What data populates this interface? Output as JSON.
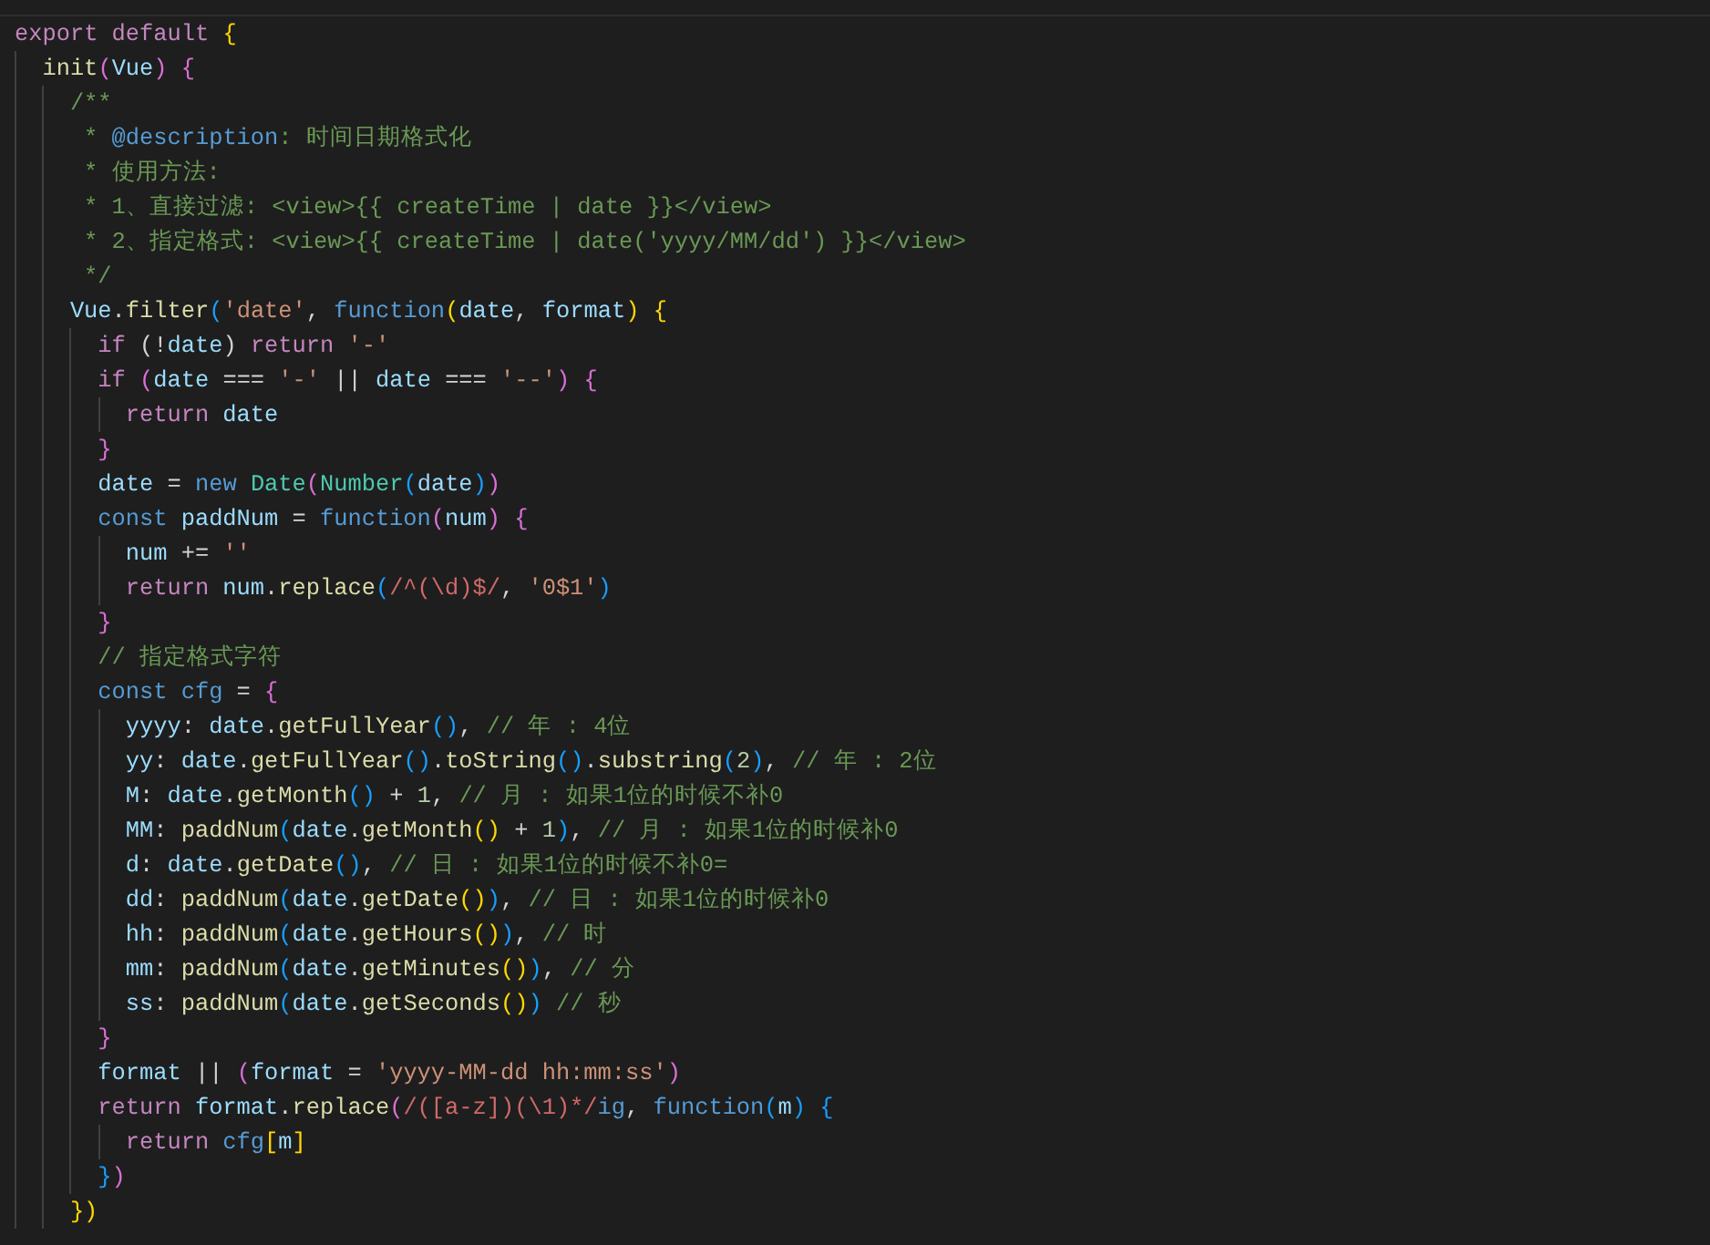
{
  "editor": {
    "lines": [
      {
        "tokens": [
          {
            "kind": "kw",
            "text": "export "
          },
          {
            "kind": "kw",
            "text": "default "
          },
          {
            "kind": "br1",
            "text": "{"
          }
        ],
        "children": [
          {
            "tokens": [
              {
                "kind": "fn",
                "text": "init"
              },
              {
                "kind": "br2",
                "text": "("
              },
              {
                "kind": "var",
                "text": "Vue"
              },
              {
                "kind": "br2",
                "text": ")"
              },
              {
                "kind": "br2",
                "text": " {"
              }
            ],
            "children": [
              {
                "tokens": [
                  {
                    "kind": "com",
                    "text": "/**"
                  }
                ]
              },
              {
                "tokens": [
                  {
                    "kind": "com",
                    "text": " * "
                  },
                  {
                    "kind": "doc",
                    "text": "@description"
                  },
                  {
                    "kind": "com",
                    "text": ": 时间日期格式化"
                  }
                ]
              },
              {
                "tokens": [
                  {
                    "kind": "com",
                    "text": " * 使用方法:"
                  }
                ]
              },
              {
                "tokens": [
                  {
                    "kind": "com",
                    "text": " * 1、直接过滤: <view>{{ createTime | date }}</view>"
                  }
                ]
              },
              {
                "tokens": [
                  {
                    "kind": "com",
                    "text": " * 2、指定格式: <view>{{ createTime | date('yyyy/MM/dd') }}</view>"
                  }
                ]
              },
              {
                "tokens": [
                  {
                    "kind": "com",
                    "text": " */"
                  }
                ]
              },
              {
                "tokens": [
                  {
                    "kind": "var",
                    "text": "Vue"
                  },
                  {
                    "kind": "pun",
                    "text": "."
                  },
                  {
                    "kind": "fn",
                    "text": "filter"
                  },
                  {
                    "kind": "br3",
                    "text": "("
                  },
                  {
                    "kind": "str",
                    "text": "'date'"
                  },
                  {
                    "kind": "pun",
                    "text": ", "
                  },
                  {
                    "kind": "st",
                    "text": "function"
                  },
                  {
                    "kind": "br1",
                    "text": "("
                  },
                  {
                    "kind": "var",
                    "text": "date"
                  },
                  {
                    "kind": "pun",
                    "text": ", "
                  },
                  {
                    "kind": "var",
                    "text": "format"
                  },
                  {
                    "kind": "br1",
                    "text": ")"
                  },
                  {
                    "kind": "br1",
                    "text": " {"
                  }
                ],
                "children": [
                  {
                    "tokens": [
                      {
                        "kind": "kw",
                        "text": "if "
                      },
                      {
                        "kind": "pun",
                        "text": "(!"
                      },
                      {
                        "kind": "var",
                        "text": "date"
                      },
                      {
                        "kind": "pun",
                        "text": ") "
                      },
                      {
                        "kind": "kw",
                        "text": "return "
                      },
                      {
                        "kind": "str",
                        "text": "'-'"
                      }
                    ]
                  },
                  {
                    "tokens": [
                      {
                        "kind": "kw",
                        "text": "if "
                      },
                      {
                        "kind": "br2",
                        "text": "("
                      },
                      {
                        "kind": "var",
                        "text": "date"
                      },
                      {
                        "kind": "pun",
                        "text": " === "
                      },
                      {
                        "kind": "str",
                        "text": "'-'"
                      },
                      {
                        "kind": "pun",
                        "text": " || "
                      },
                      {
                        "kind": "var",
                        "text": "date"
                      },
                      {
                        "kind": "pun",
                        "text": " === "
                      },
                      {
                        "kind": "str",
                        "text": "'--'"
                      },
                      {
                        "kind": "br2",
                        "text": ")"
                      },
                      {
                        "kind": "br2",
                        "text": " {"
                      }
                    ],
                    "children": [
                      {
                        "tokens": [
                          {
                            "kind": "kw",
                            "text": "return "
                          },
                          {
                            "kind": "var",
                            "text": "date"
                          }
                        ]
                      }
                    ]
                  },
                  {
                    "tokens": [
                      {
                        "kind": "br2",
                        "text": "}"
                      }
                    ]
                  },
                  {
                    "tokens": [
                      {
                        "kind": "var",
                        "text": "date"
                      },
                      {
                        "kind": "pun",
                        "text": " = "
                      },
                      {
                        "kind": "st",
                        "text": "new "
                      },
                      {
                        "kind": "cls",
                        "text": "Date"
                      },
                      {
                        "kind": "br2",
                        "text": "("
                      },
                      {
                        "kind": "cls",
                        "text": "Number"
                      },
                      {
                        "kind": "br3",
                        "text": "("
                      },
                      {
                        "kind": "var",
                        "text": "date"
                      },
                      {
                        "kind": "br3",
                        "text": ")"
                      },
                      {
                        "kind": "br2",
                        "text": ")"
                      }
                    ]
                  },
                  {
                    "tokens": [
                      {
                        "kind": "st",
                        "text": "const "
                      },
                      {
                        "kind": "var",
                        "text": "paddNum"
                      },
                      {
                        "kind": "pun",
                        "text": " = "
                      },
                      {
                        "kind": "st",
                        "text": "function"
                      },
                      {
                        "kind": "br2",
                        "text": "("
                      },
                      {
                        "kind": "var",
                        "text": "num"
                      },
                      {
                        "kind": "br2",
                        "text": ")"
                      },
                      {
                        "kind": "br2",
                        "text": " {"
                      }
                    ],
                    "children": [
                      {
                        "tokens": [
                          {
                            "kind": "var",
                            "text": "num"
                          },
                          {
                            "kind": "pun",
                            "text": " += "
                          },
                          {
                            "kind": "str",
                            "text": "''"
                          }
                        ]
                      },
                      {
                        "tokens": [
                          {
                            "kind": "kw",
                            "text": "return "
                          },
                          {
                            "kind": "var",
                            "text": "num"
                          },
                          {
                            "kind": "pun",
                            "text": "."
                          },
                          {
                            "kind": "fn",
                            "text": "replace"
                          },
                          {
                            "kind": "br3",
                            "text": "("
                          },
                          {
                            "kind": "re",
                            "text": "/^(\\d)$/"
                          },
                          {
                            "kind": "pun",
                            "text": ", "
                          },
                          {
                            "kind": "str",
                            "text": "'0$1'"
                          },
                          {
                            "kind": "br3",
                            "text": ")"
                          }
                        ]
                      }
                    ]
                  },
                  {
                    "tokens": [
                      {
                        "kind": "br2",
                        "text": "}"
                      }
                    ]
                  },
                  {
                    "tokens": [
                      {
                        "kind": "com",
                        "text": "// 指定格式字符"
                      }
                    ]
                  },
                  {
                    "tokens": [
                      {
                        "kind": "st",
                        "text": "const "
                      },
                      {
                        "kind": "st",
                        "text": "cfg"
                      },
                      {
                        "kind": "pun",
                        "text": " = "
                      },
                      {
                        "kind": "br2",
                        "text": "{"
                      }
                    ],
                    "children": [
                      {
                        "tokens": [
                          {
                            "kind": "var",
                            "text": "yyyy"
                          },
                          {
                            "kind": "pun",
                            "text": ": "
                          },
                          {
                            "kind": "var",
                            "text": "date"
                          },
                          {
                            "kind": "pun",
                            "text": "."
                          },
                          {
                            "kind": "fn",
                            "text": "getFullYear"
                          },
                          {
                            "kind": "br3",
                            "text": "()"
                          },
                          {
                            "kind": "pun",
                            "text": ", "
                          },
                          {
                            "kind": "com",
                            "text": "// 年 : 4位"
                          }
                        ]
                      },
                      {
                        "tokens": [
                          {
                            "kind": "var",
                            "text": "yy"
                          },
                          {
                            "kind": "pun",
                            "text": ": "
                          },
                          {
                            "kind": "var",
                            "text": "date"
                          },
                          {
                            "kind": "pun",
                            "text": "."
                          },
                          {
                            "kind": "fn",
                            "text": "getFullYear"
                          },
                          {
                            "kind": "br3",
                            "text": "()"
                          },
                          {
                            "kind": "pun",
                            "text": "."
                          },
                          {
                            "kind": "fn",
                            "text": "toString"
                          },
                          {
                            "kind": "br3",
                            "text": "()"
                          },
                          {
                            "kind": "pun",
                            "text": "."
                          },
                          {
                            "kind": "fn",
                            "text": "substring"
                          },
                          {
                            "kind": "br3",
                            "text": "("
                          },
                          {
                            "kind": "num",
                            "text": "2"
                          },
                          {
                            "kind": "br3",
                            "text": ")"
                          },
                          {
                            "kind": "pun",
                            "text": ", "
                          },
                          {
                            "kind": "com",
                            "text": "// 年 : 2位"
                          }
                        ]
                      },
                      {
                        "tokens": [
                          {
                            "kind": "var",
                            "text": "M"
                          },
                          {
                            "kind": "pun",
                            "text": ": "
                          },
                          {
                            "kind": "var",
                            "text": "date"
                          },
                          {
                            "kind": "pun",
                            "text": "."
                          },
                          {
                            "kind": "fn",
                            "text": "getMonth"
                          },
                          {
                            "kind": "br3",
                            "text": "()"
                          },
                          {
                            "kind": "pun",
                            "text": " + "
                          },
                          {
                            "kind": "num",
                            "text": "1"
                          },
                          {
                            "kind": "pun",
                            "text": ", "
                          },
                          {
                            "kind": "com",
                            "text": "// 月 : 如果1位的时候不补0"
                          }
                        ]
                      },
                      {
                        "tokens": [
                          {
                            "kind": "var",
                            "text": "MM"
                          },
                          {
                            "kind": "pun",
                            "text": ": "
                          },
                          {
                            "kind": "fn",
                            "text": "paddNum"
                          },
                          {
                            "kind": "br3",
                            "text": "("
                          },
                          {
                            "kind": "var",
                            "text": "date"
                          },
                          {
                            "kind": "pun",
                            "text": "."
                          },
                          {
                            "kind": "fn",
                            "text": "getMonth"
                          },
                          {
                            "kind": "br1",
                            "text": "()"
                          },
                          {
                            "kind": "pun",
                            "text": " + "
                          },
                          {
                            "kind": "num",
                            "text": "1"
                          },
                          {
                            "kind": "br3",
                            "text": ")"
                          },
                          {
                            "kind": "pun",
                            "text": ", "
                          },
                          {
                            "kind": "com",
                            "text": "// 月 : 如果1位的时候补0"
                          }
                        ]
                      },
                      {
                        "tokens": [
                          {
                            "kind": "var",
                            "text": "d"
                          },
                          {
                            "kind": "pun",
                            "text": ": "
                          },
                          {
                            "kind": "var",
                            "text": "date"
                          },
                          {
                            "kind": "pun",
                            "text": "."
                          },
                          {
                            "kind": "fn",
                            "text": "getDate"
                          },
                          {
                            "kind": "br3",
                            "text": "()"
                          },
                          {
                            "kind": "pun",
                            "text": ", "
                          },
                          {
                            "kind": "com",
                            "text": "// 日 : 如果1位的时候不补0="
                          }
                        ]
                      },
                      {
                        "tokens": [
                          {
                            "kind": "var",
                            "text": "dd"
                          },
                          {
                            "kind": "pun",
                            "text": ": "
                          },
                          {
                            "kind": "fn",
                            "text": "paddNum"
                          },
                          {
                            "kind": "br3",
                            "text": "("
                          },
                          {
                            "kind": "var",
                            "text": "date"
                          },
                          {
                            "kind": "pun",
                            "text": "."
                          },
                          {
                            "kind": "fn",
                            "text": "getDate"
                          },
                          {
                            "kind": "br1",
                            "text": "()"
                          },
                          {
                            "kind": "br3",
                            "text": ")"
                          },
                          {
                            "kind": "pun",
                            "text": ", "
                          },
                          {
                            "kind": "com",
                            "text": "// 日 : 如果1位的时候补0"
                          }
                        ]
                      },
                      {
                        "tokens": [
                          {
                            "kind": "var",
                            "text": "hh"
                          },
                          {
                            "kind": "pun",
                            "text": ": "
                          },
                          {
                            "kind": "fn",
                            "text": "paddNum"
                          },
                          {
                            "kind": "br3",
                            "text": "("
                          },
                          {
                            "kind": "var",
                            "text": "date"
                          },
                          {
                            "kind": "pun",
                            "text": "."
                          },
                          {
                            "kind": "fn",
                            "text": "getHours"
                          },
                          {
                            "kind": "br1",
                            "text": "()"
                          },
                          {
                            "kind": "br3",
                            "text": ")"
                          },
                          {
                            "kind": "pun",
                            "text": ", "
                          },
                          {
                            "kind": "com",
                            "text": "// 时"
                          }
                        ]
                      },
                      {
                        "tokens": [
                          {
                            "kind": "var",
                            "text": "mm"
                          },
                          {
                            "kind": "pun",
                            "text": ": "
                          },
                          {
                            "kind": "fn",
                            "text": "paddNum"
                          },
                          {
                            "kind": "br3",
                            "text": "("
                          },
                          {
                            "kind": "var",
                            "text": "date"
                          },
                          {
                            "kind": "pun",
                            "text": "."
                          },
                          {
                            "kind": "fn",
                            "text": "getMinutes"
                          },
                          {
                            "kind": "br1",
                            "text": "()"
                          },
                          {
                            "kind": "br3",
                            "text": ")"
                          },
                          {
                            "kind": "pun",
                            "text": ", "
                          },
                          {
                            "kind": "com",
                            "text": "// 分"
                          }
                        ]
                      },
                      {
                        "tokens": [
                          {
                            "kind": "var",
                            "text": "ss"
                          },
                          {
                            "kind": "pun",
                            "text": ": "
                          },
                          {
                            "kind": "fn",
                            "text": "paddNum"
                          },
                          {
                            "kind": "br3",
                            "text": "("
                          },
                          {
                            "kind": "var",
                            "text": "date"
                          },
                          {
                            "kind": "pun",
                            "text": "."
                          },
                          {
                            "kind": "fn",
                            "text": "getSeconds"
                          },
                          {
                            "kind": "br1",
                            "text": "()"
                          },
                          {
                            "kind": "br3",
                            "text": ")"
                          },
                          {
                            "kind": "com",
                            "text": " // 秒"
                          }
                        ]
                      }
                    ]
                  },
                  {
                    "tokens": [
                      {
                        "kind": "br2",
                        "text": "}"
                      }
                    ]
                  },
                  {
                    "tokens": [
                      {
                        "kind": "var",
                        "text": "format"
                      },
                      {
                        "kind": "pun",
                        "text": " || "
                      },
                      {
                        "kind": "br2",
                        "text": "("
                      },
                      {
                        "kind": "var",
                        "text": "format"
                      },
                      {
                        "kind": "pun",
                        "text": " = "
                      },
                      {
                        "kind": "str",
                        "text": "'yyyy-MM-dd hh:mm:ss'"
                      },
                      {
                        "kind": "br2",
                        "text": ")"
                      }
                    ]
                  },
                  {
                    "tokens": [
                      {
                        "kind": "kw",
                        "text": "return "
                      },
                      {
                        "kind": "var",
                        "text": "format"
                      },
                      {
                        "kind": "pun",
                        "text": "."
                      },
                      {
                        "kind": "fn",
                        "text": "replace"
                      },
                      {
                        "kind": "br2",
                        "text": "("
                      },
                      {
                        "kind": "re",
                        "text": "/([a-z])(\\1)*/"
                      },
                      {
                        "kind": "st",
                        "text": "ig"
                      },
                      {
                        "kind": "pun",
                        "text": ", "
                      },
                      {
                        "kind": "st",
                        "text": "function"
                      },
                      {
                        "kind": "br3",
                        "text": "("
                      },
                      {
                        "kind": "var",
                        "text": "m"
                      },
                      {
                        "kind": "br3",
                        "text": ")"
                      },
                      {
                        "kind": "br3",
                        "text": " {"
                      }
                    ],
                    "children": [
                      {
                        "tokens": [
                          {
                            "kind": "kw",
                            "text": "return "
                          },
                          {
                            "kind": "st",
                            "text": "cfg"
                          },
                          {
                            "kind": "br1",
                            "text": "["
                          },
                          {
                            "kind": "var",
                            "text": "m"
                          },
                          {
                            "kind": "br1",
                            "text": "]"
                          }
                        ]
                      }
                    ]
                  },
                  {
                    "tokens": [
                      {
                        "kind": "br3",
                        "text": "}"
                      },
                      {
                        "kind": "br2",
                        "text": ")"
                      }
                    ]
                  }
                ]
              },
              {
                "tokens": [
                  {
                    "kind": "br1",
                    "text": "})"
                  }
                ]
              }
            ]
          }
        ]
      }
    ]
  }
}
